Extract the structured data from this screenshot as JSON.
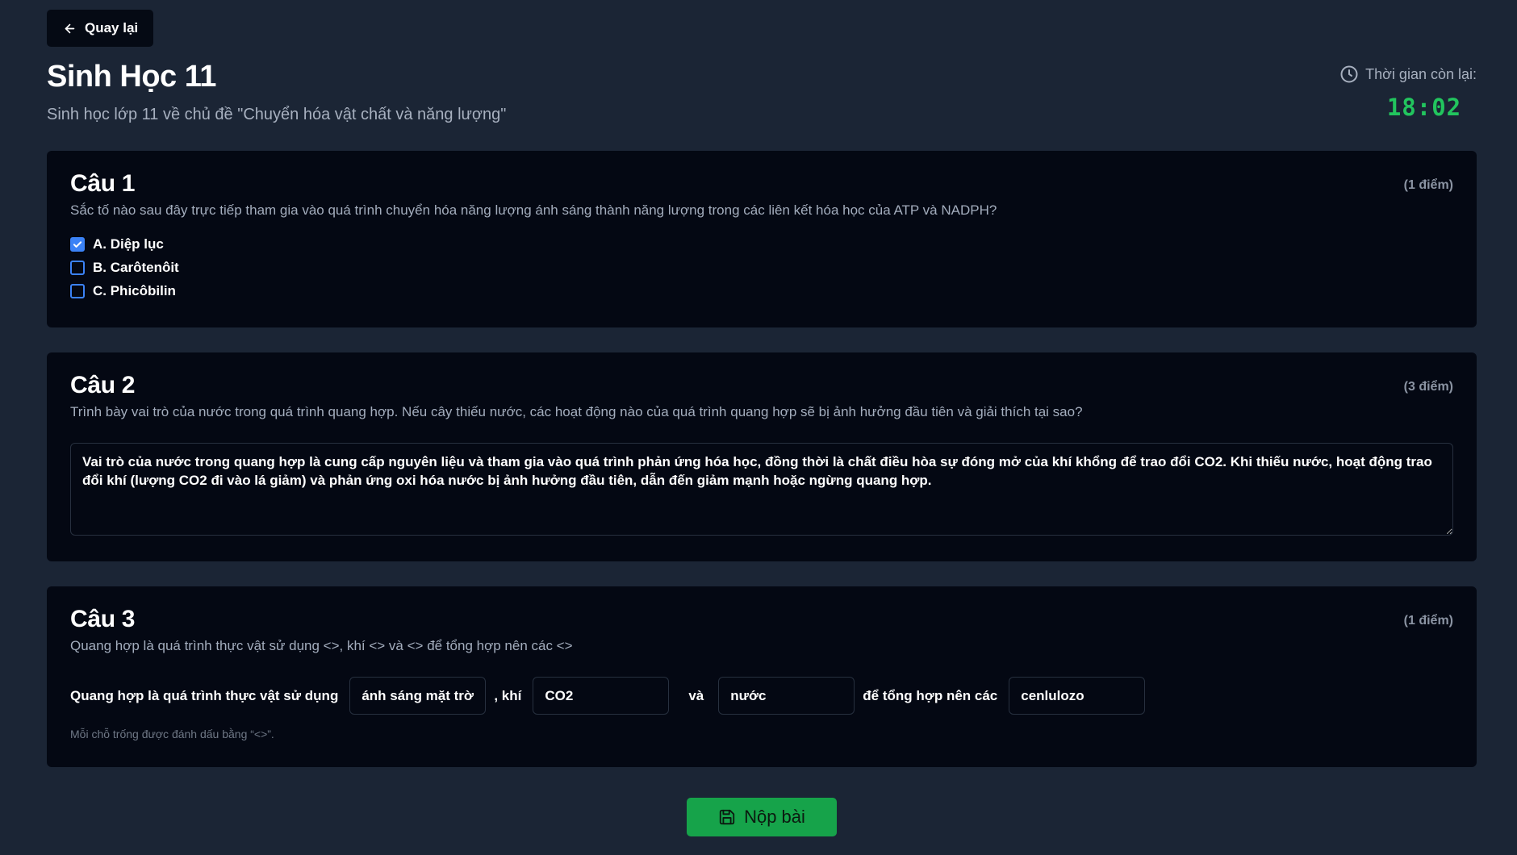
{
  "header": {
    "back_label": "Quay lại",
    "title": "Sinh Học 11",
    "subtitle": "Sinh học lớp 11 về chủ đề \"Chuyển hóa vật chất và năng lượng\""
  },
  "timer": {
    "label": "Thời gian còn lại:",
    "value": "18:02",
    "color": "#22c55e"
  },
  "questions": [
    {
      "title": "Câu 1",
      "points": "(1 điểm)",
      "text": "Sắc tố nào sau đây trực tiếp tham gia vào quá trình chuyển hóa năng lượng ánh sáng thành năng lượng trong các liên kết hóa học của ATP và NADPH?",
      "options": [
        {
          "label": "A. Diệp lục",
          "checked": true
        },
        {
          "label": "B. Carôtenôit",
          "checked": false
        },
        {
          "label": "C. Phicôbilin",
          "checked": false
        }
      ]
    },
    {
      "title": "Câu 2",
      "points": "(3 điểm)",
      "text": "Trình bày vai trò của nước trong quá trình quang hợp. Nếu cây thiếu nước, các hoạt động nào của quá trình quang hợp sẽ bị ảnh hưởng đầu tiên và giải thích tại sao?",
      "answer": "Vai trò của nước trong quang hợp là cung cấp nguyên liệu và tham gia vào quá trình phản ứng hóa học, đồng thời là chất điều hòa sự đóng mở của khí khổng để trao đổi CO2. Khi thiếu nước, hoạt động trao đổi khí (lượng CO2 đi vào lá giảm) và phản ứng oxi hóa nước bị ảnh hưởng đầu tiên, dẫn đến giảm mạnh hoặc ngừng quang hợp."
    },
    {
      "title": "Câu 3",
      "points": "(1 điểm)",
      "text": "Quang hợp là quá trình thực vật sử dụng <>, khí <> và <> để tổng hợp nên các <>",
      "segments": [
        "Quang hợp là quá trình thực vật sử dụng",
        ", khí",
        "và",
        "để tổng hợp nên các"
      ],
      "blanks": [
        "ánh sáng mặt trời",
        "CO2",
        "nước",
        "cenlulozo"
      ],
      "hint": "Mỗi chỗ trống được đánh dấu bằng “<>”."
    }
  ],
  "submit_label": "Nộp bài",
  "colors": {
    "background": "#1b2535",
    "card": "#040813",
    "accent_blue": "#3b82f6",
    "submit_green": "#16a34a"
  }
}
